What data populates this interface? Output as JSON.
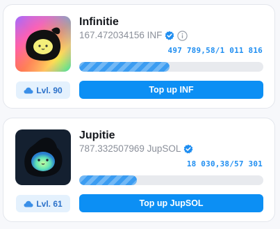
{
  "colors": {
    "accent": "#0c8ff4",
    "progress_text": "#1f8ef1",
    "level_bg": "#e4f1fd",
    "level_text": "#2b71c9",
    "verified": "#1f8ef1"
  },
  "cards": [
    {
      "name": "Infinitie",
      "balance": "167.472034156 INF",
      "progress_text": "497 789,58/1 011 816",
      "progress_fraction": 0.492,
      "level": "Lvl. 90",
      "button": "Top up INF",
      "icons": [
        "verified-badge-icon",
        "info-icon",
        "cloud-icon"
      ]
    },
    {
      "name": "Jupitie",
      "balance": "787.332507969 JupSOL",
      "progress_text": "18 030,38/57 301",
      "progress_fraction": 0.315,
      "level": "Lvl. 61",
      "button": "Top up JupSOL",
      "icons": [
        "verified-badge-icon",
        "cloud-icon"
      ]
    }
  ]
}
